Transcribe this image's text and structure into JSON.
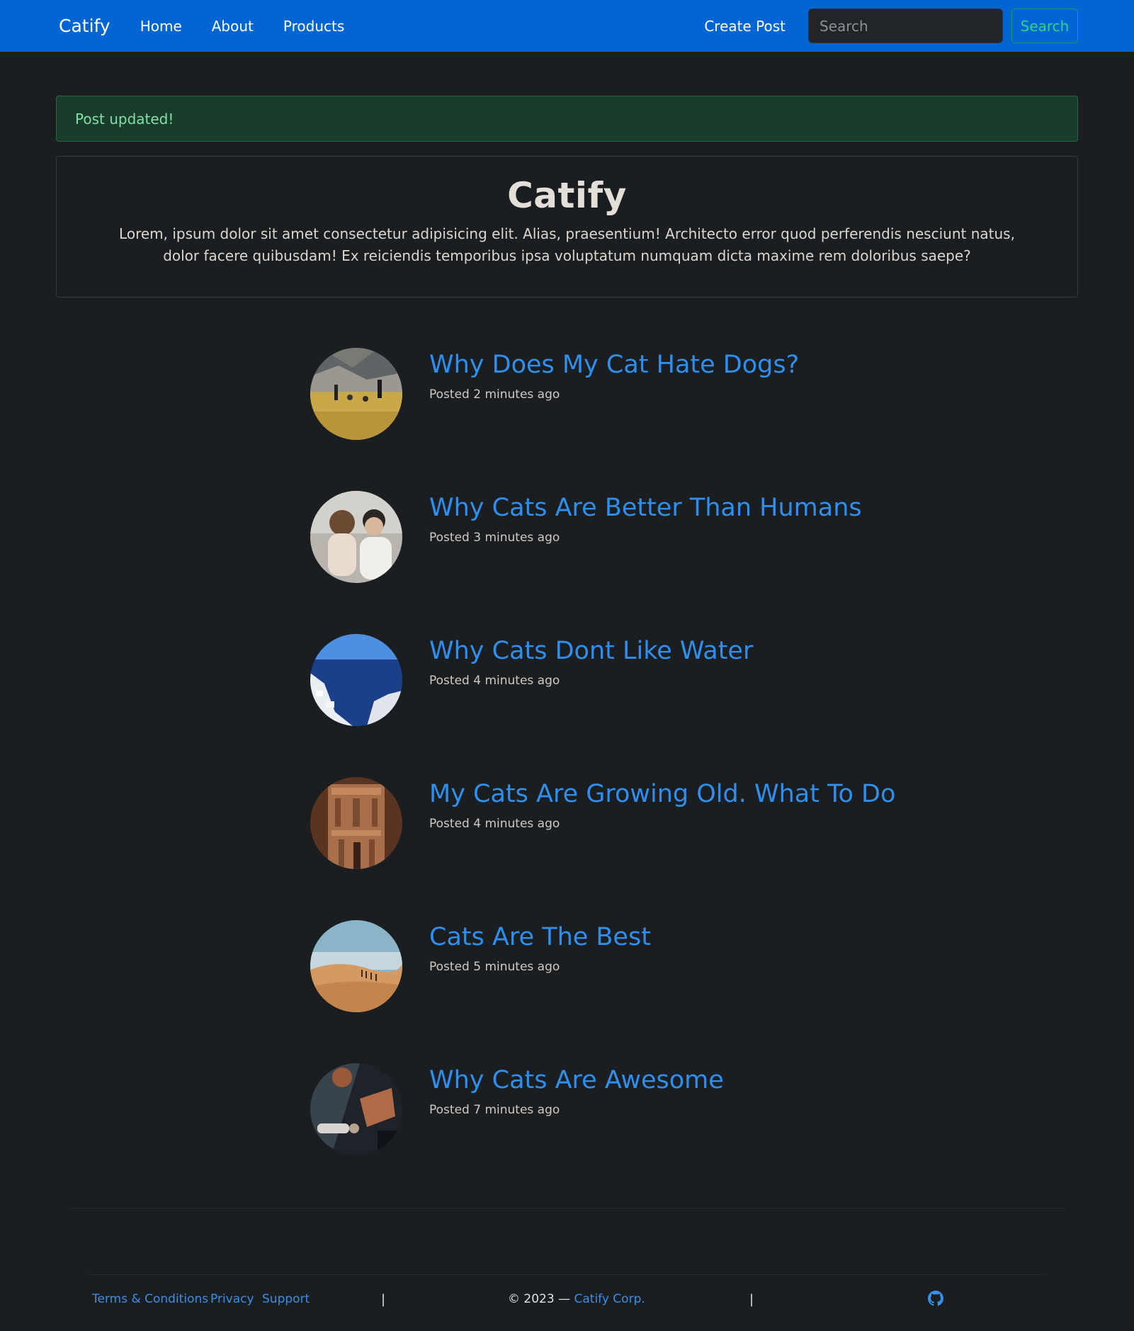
{
  "navbar": {
    "brand": "Catify",
    "links": [
      "Home",
      "About",
      "Products"
    ],
    "create_post": "Create Post",
    "search_placeholder": "Search",
    "search_button": "Search"
  },
  "alert": {
    "message": "Post updated!"
  },
  "hero": {
    "title": "Catify",
    "text": "Lorem, ipsum dolor sit amet consectetur adipisicing elit. Alias, praesentium! Architecto error quod perferendis nesciunt natus, dolor facere quibusdam! Ex reiciendis temporibus ipsa voluptatum numquam dicta maxime rem doloribus saepe?"
  },
  "posts": [
    {
      "title": "Why Does My Cat Hate Dogs?",
      "meta": "Posted 2 minutes ago"
    },
    {
      "title": "Why Cats Are Better Than Humans",
      "meta": "Posted 3 minutes ago"
    },
    {
      "title": "Why Cats Dont Like Water",
      "meta": "Posted 4 minutes ago"
    },
    {
      "title": "My Cats Are Growing Old. What To Do",
      "meta": "Posted 4 minutes ago"
    },
    {
      "title": "Cats Are The Best",
      "meta": "Posted 5 minutes ago"
    },
    {
      "title": "Why Cats Are Awesome",
      "meta": "Posted 7 minutes ago"
    }
  ],
  "footer": {
    "links": [
      "Terms & Conditions",
      "Privacy",
      "Support"
    ],
    "separator": "|",
    "copyright_prefix": "© 2023 — ",
    "company": "Catify Corp.",
    "github_icon": "github-icon"
  },
  "colors": {
    "navbar": "#0265d3",
    "background": "#1b1e21",
    "link": "#2f8fee",
    "alert_bg": "#1b3b2b",
    "alert_text": "#7ee2a8"
  }
}
